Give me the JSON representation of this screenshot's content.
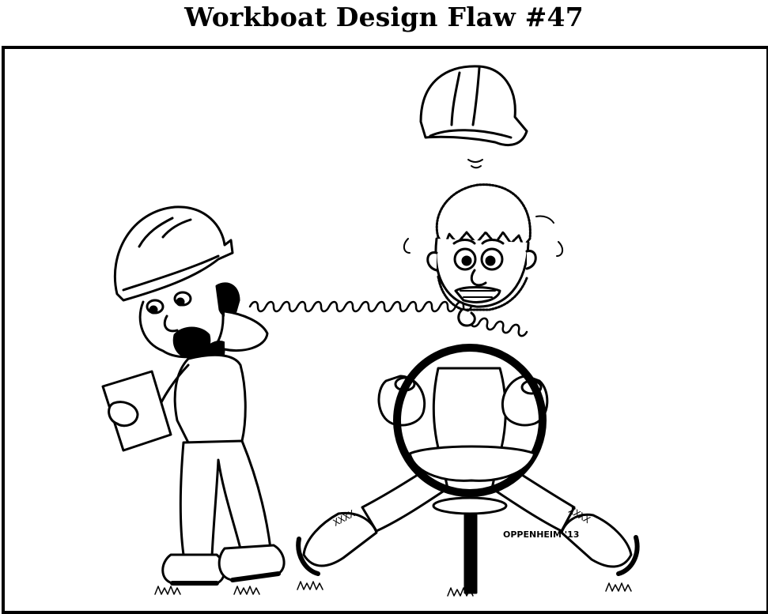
{
  "title": "Workboat Design Flaw #47",
  "signature": "OPPENHEIM '13",
  "boot_marks": "XXXX",
  "ink_color": "#000000",
  "paper_color": "#ffffff"
}
